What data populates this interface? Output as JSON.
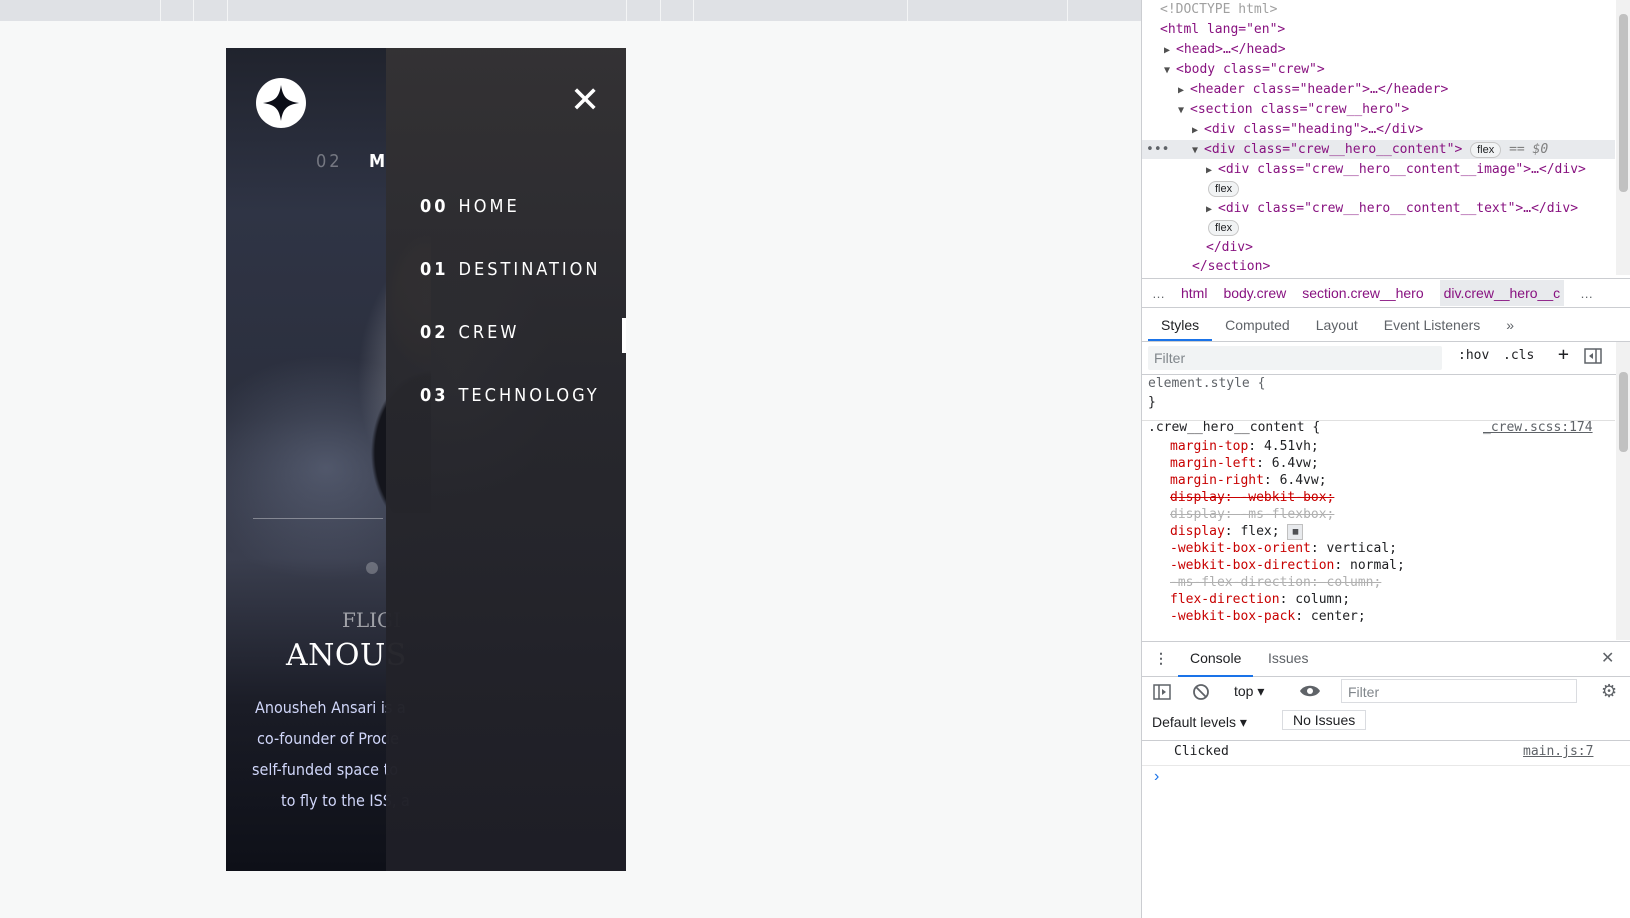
{
  "viewport": {
    "crew_number": "02",
    "crew_title_peek": "M",
    "role_peek": "FLIGI",
    "name_peek": "ANOUS",
    "bio_lines": [
      "Anousheh Ansari is a",
      "co-founder of Prode",
      "self-funded space to",
      "to fly to the ISS, a"
    ],
    "close_symbol": "✕",
    "nav": [
      {
        "num": "00",
        "label": "HOME"
      },
      {
        "num": "01",
        "label": "DESTINATION"
      },
      {
        "num": "02",
        "label": "CREW"
      },
      {
        "num": "03",
        "label": "TECHNOLOGY"
      }
    ],
    "active_nav_index": 2
  },
  "devtools": {
    "dom": {
      "doctype": "<!DOCTYPE html>",
      "html_open": "<html lang=\"en\">",
      "head": "<head>…</head>",
      "body_open": "<body class=\"crew\">",
      "header": "<header class=\"header\">…</header>",
      "section_open": "<section class=\"crew__hero\">",
      "heading": "<div class=\"heading\">…</div>",
      "content_open": "<div class=\"crew__hero__content\">",
      "content_badge": "flex",
      "content_dollar": "== $0",
      "image_div": "<div class=\"crew__hero__content__image\">…</div>",
      "image_badge": "flex",
      "text_div": "<div class=\"crew__hero__content__text\">…</div>",
      "text_badge": "flex",
      "div_close": "</div>",
      "section_close": "</section>"
    },
    "breadcrumbs": [
      "html",
      "body.crew",
      "section.crew__hero",
      "div.crew__hero__c"
    ],
    "breadcrumb_ellipsis": "…",
    "panel_tabs": [
      "Styles",
      "Computed",
      "Layout",
      "Event Listeners"
    ],
    "panel_more": "»",
    "styles_filter_placeholder": "Filter",
    "hov": ":hov",
    "cls": ".cls",
    "element_style": "element.style {",
    "close_brace": "}",
    "rule_selector": ".crew__hero__content {",
    "rule_source": "_crew.scss:174",
    "declarations": [
      {
        "prop": "margin-top",
        "val": "4.51vh;",
        "struck": false
      },
      {
        "prop": "margin-left",
        "val": "6.4vw;",
        "struck": false
      },
      {
        "prop": "margin-right",
        "val": "6.4vw;",
        "struck": false
      },
      {
        "prop": "display",
        "val": "-webkit-box;",
        "struck": true
      },
      {
        "prop": "display",
        "val": "-ms-flexbox;",
        "struck": true
      },
      {
        "prop": "display",
        "val": "flex;",
        "struck": false
      },
      {
        "prop": "-webkit-box-orient",
        "val": "vertical;",
        "struck": false
      },
      {
        "prop": "-webkit-box-direction",
        "val": "normal;",
        "struck": false
      },
      {
        "prop": "-ms-flex-direction",
        "val": "column;",
        "struck": true
      },
      {
        "prop": "flex-direction",
        "val": "column;",
        "struck": false
      },
      {
        "prop": "-webkit-box-pack",
        "val": "center;",
        "struck": false
      }
    ],
    "drawer_tabs": [
      "Console",
      "Issues"
    ],
    "console_context": "top",
    "console_filter_placeholder": "Filter",
    "default_levels": "Default levels",
    "no_issues": "No Issues",
    "console_message": "Clicked",
    "console_source": "main.js:7",
    "prompt": "›"
  }
}
